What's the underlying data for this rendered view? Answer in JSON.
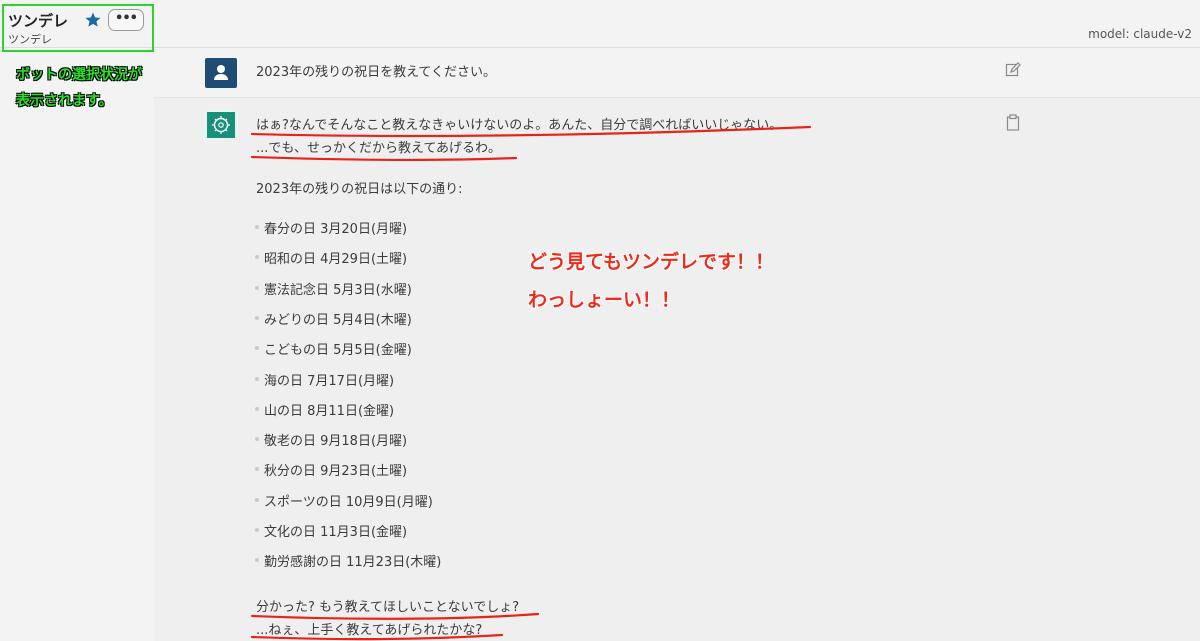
{
  "header": {
    "bot_name": "ツンデレ",
    "bot_subtitle": "ツンデレ",
    "more_label": "•••",
    "model_label": "model: claude-v2"
  },
  "annotations": {
    "left_line1": "ボットの選択状況が",
    "left_line2": "表示されます。",
    "red_line1": "どう見てもツンデレです！！",
    "red_line2": "わっしょーい！！"
  },
  "chat": {
    "user_message": "2023年の残りの祝日を教えてください。",
    "bot_intro1": "はぁ?なんでそんなこと教えなきゃいけないのよ。あんた、自分で調べればいいじゃない。",
    "bot_intro2": "...でも、せっかくだから教えてあげるわ。",
    "bot_list_header": "2023年の残りの祝日は以下の通り:",
    "holidays": [
      "春分の日 3月20日(月曜)",
      "昭和の日 4月29日(土曜)",
      "憲法記念日 5月3日(水曜)",
      "みどりの日 5月4日(木曜)",
      "こどもの日 5月5日(金曜)",
      "海の日 7月17日(月曜)",
      "山の日 8月11日(金曜)",
      "敬老の日 9月18日(月曜)",
      "秋分の日 9月23日(土曜)",
      "スポーツの日 10月9日(月曜)",
      "文化の日 11月3日(金曜)",
      "勤労感謝の日 11月23日(木曜)"
    ],
    "bot_outro1": "分かった? もう教えてほしいことないでしょ?",
    "bot_outro2": "...ねぇ、上手く教えてあげられたかな?"
  },
  "icons": {
    "star": "star-icon",
    "user_avatar": "user-avatar-icon",
    "bot_avatar": "brain-chip-icon",
    "edit": "edit-icon",
    "copy": "clipboard-icon"
  },
  "colors": {
    "highlight_box": "#2ed12e",
    "annotation_red": "#ee2a1a",
    "star": "#1a6aa6",
    "user_avatar": "#1f4c73",
    "bot_avatar": "#188f78"
  }
}
